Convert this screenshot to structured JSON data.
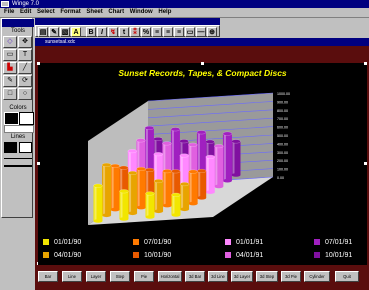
{
  "app": {
    "title": "Winge 7.0",
    "document_title": "sunsetsal.xdc"
  },
  "menu": [
    "File",
    "Edit",
    "Select",
    "Format",
    "Sheet",
    "Chart",
    "Window",
    "Help"
  ],
  "palette": {
    "title": "Tools",
    "colors_label": "Colors",
    "lines_label": "Lines"
  },
  "chart_data": {
    "type": "bar",
    "title": "Sunset Records, Tapes, & Compact Discs",
    "ylim": [
      0,
      1000
    ],
    "y_ticks": [
      "1000.00",
      "900.00",
      "800.00",
      "700.00",
      "600.00",
      "500.00",
      "400.00",
      "300.00",
      "200.00",
      "100.00",
      "0.00"
    ],
    "legend_placement": "bottom",
    "series": [
      {
        "name": "01/01/90",
        "color": "#f2e600"
      },
      {
        "name": "04/01/90",
        "color": "#e8a400"
      },
      {
        "name": "07/01/90",
        "color": "#ff7a00"
      },
      {
        "name": "10/01/90",
        "color": "#e85a00"
      },
      {
        "name": "01/01/91",
        "color": "#ff88ff"
      },
      {
        "name": "04/01/91",
        "color": "#e060e0"
      },
      {
        "name": "07/01/91",
        "color": "#a020c0"
      },
      {
        "name": "10/01/91",
        "color": "#8010a0"
      }
    ],
    "heights": [
      [
        420,
        330,
        280,
        240
      ],
      [
        600,
        480,
        360,
        300
      ],
      [
        520,
        460,
        410,
        380
      ],
      [
        430,
        380,
        340,
        320
      ],
      [
        560,
        500,
        460,
        420
      ],
      [
        620,
        560,
        520,
        480
      ],
      [
        700,
        660,
        600,
        560
      ],
      [
        500,
        450,
        420,
        400
      ]
    ]
  },
  "buttons": [
    "Bar",
    "Line",
    "Layer",
    "Step",
    "Pie",
    "Horizontal",
    "3d Bar",
    "3d Line",
    "3d Layer",
    "3d Step",
    "3d Pie",
    "Cylinder",
    "Quit"
  ]
}
